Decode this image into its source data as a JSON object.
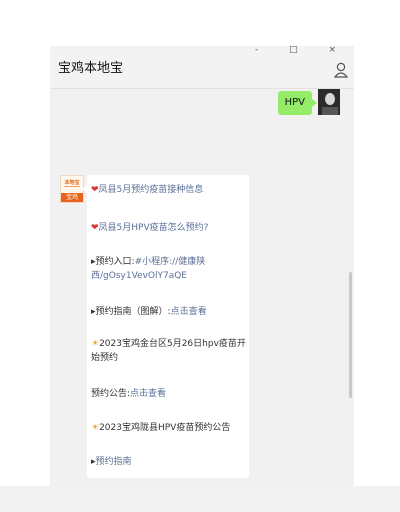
{
  "window": {
    "controls": [
      "-",
      "□",
      "×"
    ]
  },
  "header": {
    "title": "宝鸡本地宝"
  },
  "sent_message": {
    "text": "HPV"
  },
  "bot_avatar": {
    "top_text": "本地宝",
    "bottom_text": "宝鸡"
  },
  "message": {
    "line1_icon": "❤",
    "line1_text": "凤县5月预约疫苗接种信息",
    "line2_icon": "❤",
    "line2_text": "凤县5月HPV疫苗怎么预约?",
    "line3_prefix": "▸预约入口:",
    "line3_link": "#小程序://健康陕西/gOsy1VevOlY7aQE",
    "line4_prefix": "▸预约指南（图解）:",
    "line4_link": "点击查看",
    "line5_icon": "☀",
    "line5_text": "2023宝鸡金台区5月26日hpv疫苗开始预约",
    "line6_prefix": "预约公告:",
    "line6_link": "点击查看",
    "line7_icon": "☀",
    "line7_text": "2023宝鸡陇县HPV疫苗预约公告",
    "line8_prefix": "▸",
    "line8_link": "预约指南"
  },
  "icons": [
    "person-icon",
    "heart-icon",
    "sun-icon"
  ],
  "colors": {
    "sent_bubble": "#95ec69",
    "link": "#5b6f97",
    "avatar_orange": "#e8641c"
  }
}
